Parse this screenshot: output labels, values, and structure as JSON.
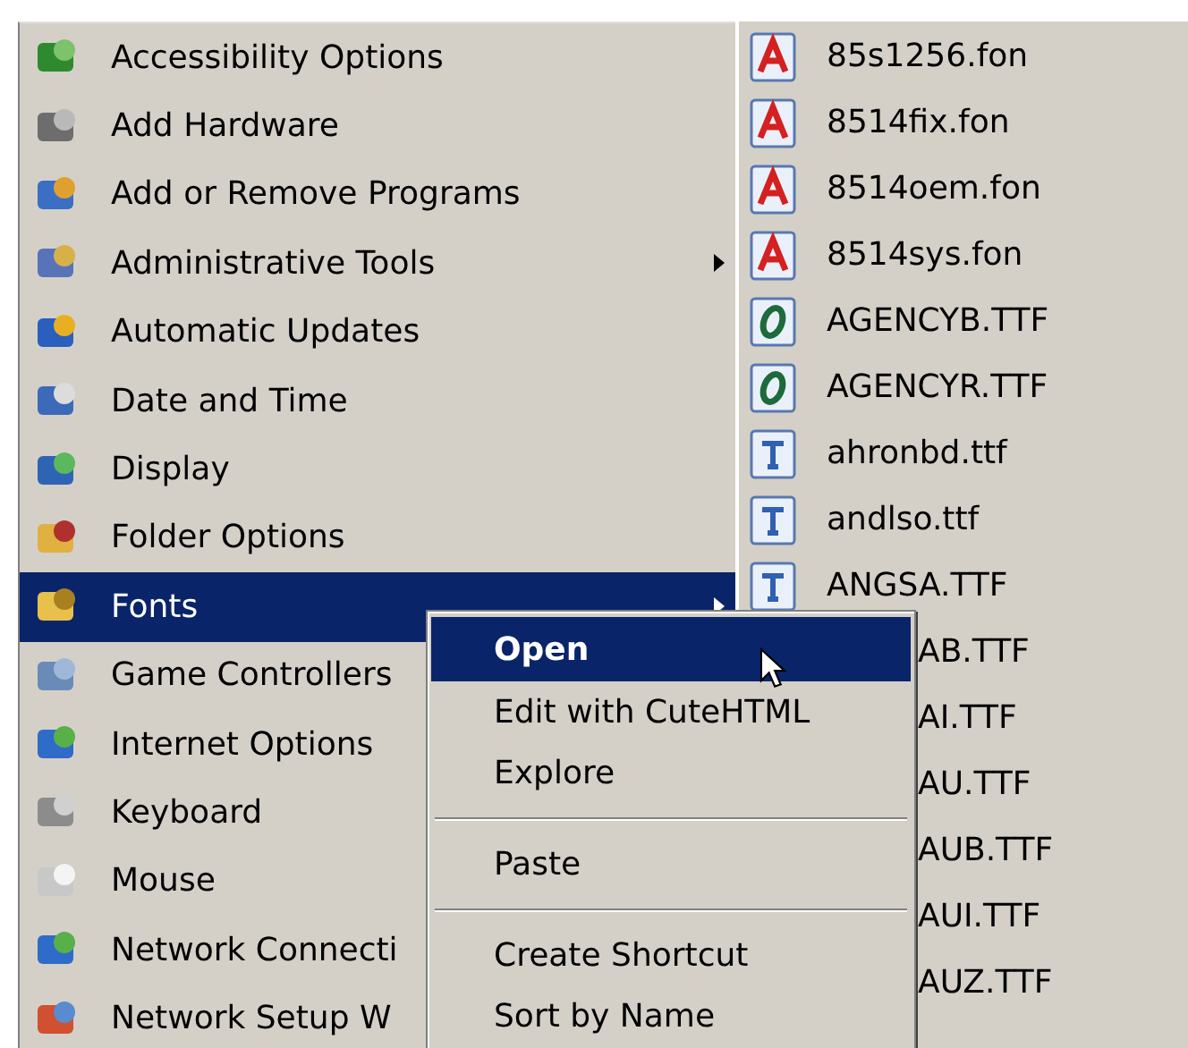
{
  "control_panel_menu": {
    "items": [
      {
        "label": "Accessibility Options",
        "submenu": false,
        "selected": false
      },
      {
        "label": "Add Hardware",
        "submenu": false,
        "selected": false
      },
      {
        "label": "Add or Remove Programs",
        "submenu": false,
        "selected": false
      },
      {
        "label": "Administrative Tools",
        "submenu": true,
        "selected": false
      },
      {
        "label": "Automatic Updates",
        "submenu": false,
        "selected": false
      },
      {
        "label": "Date and Time",
        "submenu": false,
        "selected": false
      },
      {
        "label": "Display",
        "submenu": false,
        "selected": false
      },
      {
        "label": "Folder Options",
        "submenu": false,
        "selected": false
      },
      {
        "label": "Fonts",
        "submenu": true,
        "selected": true
      },
      {
        "label": "Game Controllers",
        "submenu": false,
        "selected": false
      },
      {
        "label": "Internet Options",
        "submenu": false,
        "selected": false
      },
      {
        "label": "Keyboard",
        "submenu": false,
        "selected": false
      },
      {
        "label": "Mouse",
        "submenu": false,
        "selected": false
      },
      {
        "label": "Network Connecti",
        "submenu": false,
        "selected": false
      },
      {
        "label": "Network Setup W",
        "submenu": false,
        "selected": false
      }
    ]
  },
  "fonts_menu": {
    "items": [
      {
        "kind": "fon",
        "label": "85s1256.fon"
      },
      {
        "kind": "fon",
        "label": "8514fix.fon"
      },
      {
        "kind": "fon",
        "label": "8514oem.fon"
      },
      {
        "kind": "fon",
        "label": "8514sys.fon"
      },
      {
        "kind": "otf",
        "label": "AGENCYB.TTF"
      },
      {
        "kind": "otf",
        "label": "AGENCYR.TTF"
      },
      {
        "kind": "ttf",
        "label": "ahronbd.ttf"
      },
      {
        "kind": "ttf",
        "label": "andlso.ttf"
      },
      {
        "kind": "ttf",
        "label": "ANGSA.TTF"
      },
      {
        "kind": "cut",
        "label": "AB.TTF"
      },
      {
        "kind": "cut",
        "label": "AI.TTF"
      },
      {
        "kind": "cut",
        "label": "AU.TTF"
      },
      {
        "kind": "cut",
        "label": "AUB.TTF"
      },
      {
        "kind": "cut",
        "label": "AUI.TTF"
      },
      {
        "kind": "cut",
        "label": "AUZ.TTF"
      }
    ]
  },
  "context_menu": {
    "items": [
      {
        "kind": "item",
        "label": "Open",
        "default": true,
        "selected": true
      },
      {
        "kind": "item",
        "label": "Edit with CuteHTML",
        "default": false,
        "selected": false
      },
      {
        "kind": "item",
        "label": "Explore",
        "default": false,
        "selected": false
      },
      {
        "kind": "separator"
      },
      {
        "kind": "item",
        "label": "Paste",
        "default": false,
        "selected": false
      },
      {
        "kind": "separator"
      },
      {
        "kind": "item",
        "label": "Create Shortcut",
        "default": false,
        "selected": false
      },
      {
        "kind": "item",
        "label": "Sort by Name",
        "default": false,
        "selected": false
      }
    ]
  }
}
